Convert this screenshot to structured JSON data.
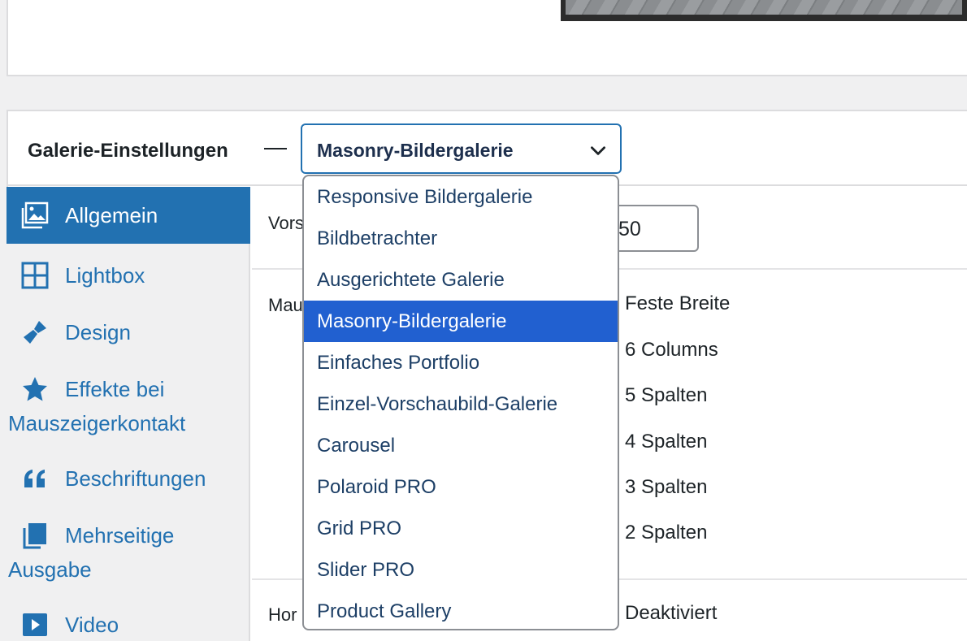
{
  "settings": {
    "title": "Galerie-Einstellungen",
    "selected_gallery": "Masonry-Bildergalerie"
  },
  "sidebar": {
    "items": [
      {
        "label": "Allgemein",
        "icon": "image-gallery-icon",
        "active": true
      },
      {
        "label": "Lightbox",
        "icon": "grid-icon"
      },
      {
        "label": "Design",
        "icon": "paint-brush-icon"
      },
      {
        "label": "Effekte bei",
        "label2": "Mauszeigerkontakt",
        "icon": "star-icon"
      },
      {
        "label": "Beschriftungen",
        "icon": "quote-icon"
      },
      {
        "label": "Mehrseitige",
        "label2": "Ausgabe",
        "icon": "pages-icon"
      },
      {
        "label": "Video",
        "icon": "video-play-icon"
      }
    ]
  },
  "content": {
    "row1_label": "Vors",
    "row1_value": "50",
    "row2_label": "Mau",
    "row3_label": "Hor",
    "column_options": [
      "Feste Breite",
      "6 Columns",
      "5 Spalten",
      "4 Spalten",
      "3 Spalten",
      "2 Spalten"
    ],
    "row3_value": "Deaktiviert"
  },
  "dropdown": {
    "options": [
      "Responsive Bildergalerie",
      "Bildbetrachter",
      "Ausgerichtete Galerie",
      "Masonry-Bildergalerie",
      "Einfaches Portfolio",
      "Einzel-Vorschaubild-Galerie",
      "Carousel",
      "Polaroid PRO",
      "Grid PRO",
      "Slider PRO",
      "Product Gallery"
    ],
    "selected_index": 3
  },
  "colors": {
    "accent": "#2271b1",
    "selected_option": "#2160d0"
  }
}
